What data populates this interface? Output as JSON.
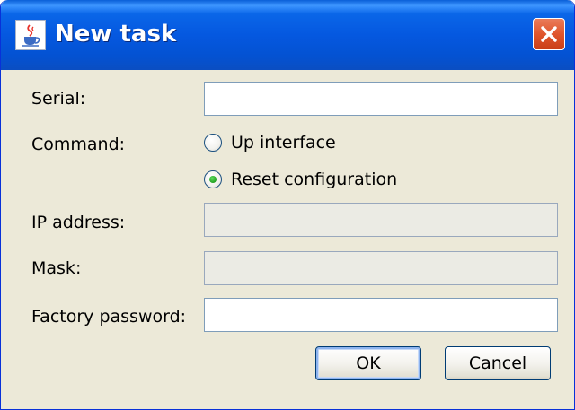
{
  "window": {
    "title": "New task",
    "title_icon": "java-cup-icon",
    "close_icon": "close-icon"
  },
  "form": {
    "serial": {
      "label": "Serial:",
      "value": ""
    },
    "command": {
      "label": "Command:",
      "options": [
        {
          "label": "Up interface",
          "selected": false
        },
        {
          "label": "Reset configuration",
          "selected": true
        }
      ]
    },
    "ip_address": {
      "label": "IP address:",
      "value": "",
      "enabled": false
    },
    "mask": {
      "label": "Mask:",
      "value": "",
      "enabled": false
    },
    "factory_password": {
      "label": "Factory password:",
      "value": ""
    }
  },
  "buttons": {
    "ok_label": "OK",
    "cancel_label": "Cancel"
  },
  "colors": {
    "titlebar": "#0558e0",
    "dialog_bg": "#ece9d8",
    "close_button": "#e0552c",
    "radio_selected": "#21a121"
  }
}
